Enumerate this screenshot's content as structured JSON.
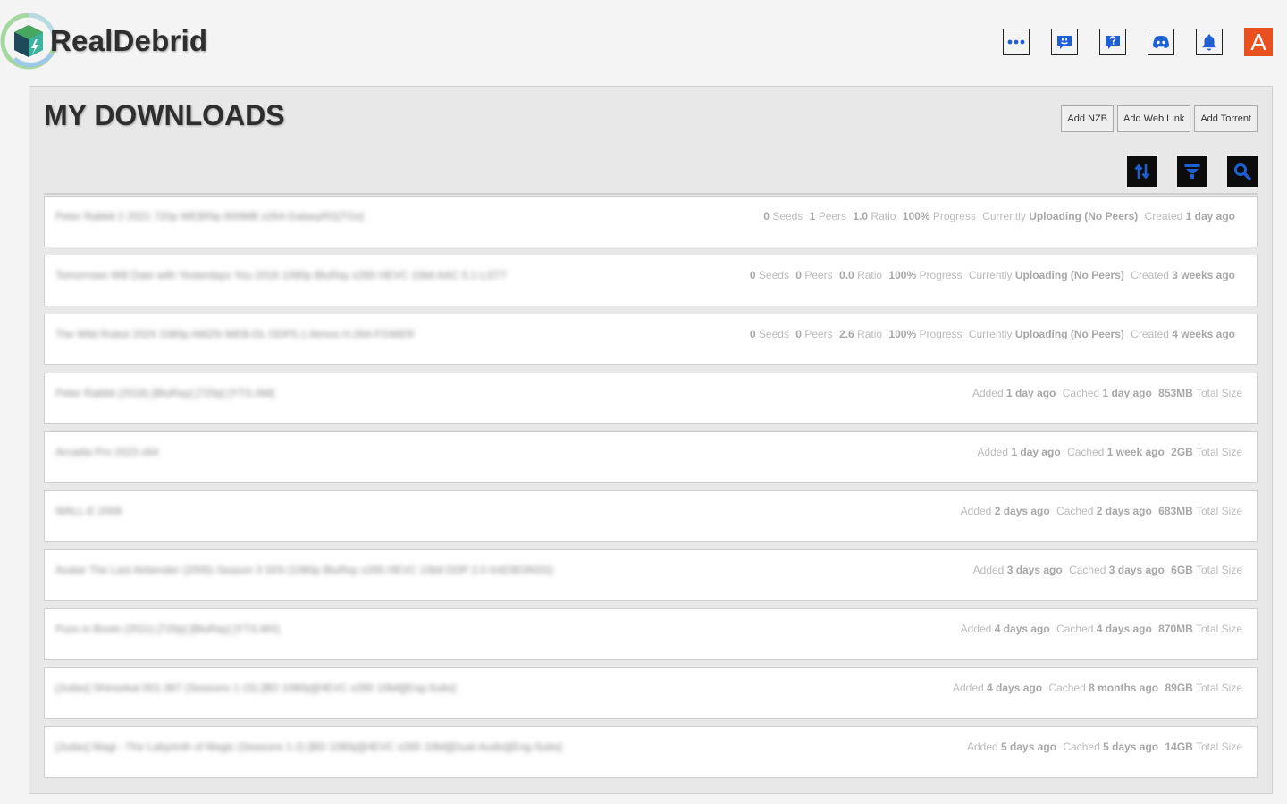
{
  "app": {
    "brand": "RealDebrid"
  },
  "header": {
    "icons": [
      "more-icon",
      "feedback-icon",
      "support-icon",
      "discord-icon",
      "bell-icon"
    ],
    "avatar_letter": "A"
  },
  "page": {
    "title": "MY DOWNLOADS",
    "buttons": {
      "add_nzb": "Add NZB",
      "add_web_link": "Add Web Link",
      "add_torrent": "Add Torrent"
    }
  },
  "labels": {
    "seeds": "Seeds",
    "peers": "Peers",
    "ratio": "Ratio",
    "progress": "Progress",
    "currently": "Currently",
    "created": "Created",
    "added": "Added",
    "cached": "Cached",
    "total_size": "Total Size"
  },
  "colors": {
    "accent": "#1e5fd4",
    "avatar_bg": "#e8511f",
    "logo_green": "#3fb04a"
  },
  "torrents": [
    {
      "name": "Peter Rabbit 2 2021 720p WEBRip 800MB x264-GalaxyRG[TGx]",
      "seeds": "0",
      "peers": "1",
      "ratio": "1.0",
      "progress": "100%",
      "status": "Uploading (No Peers)",
      "created": "1 day ago"
    },
    {
      "name": "Tomorrows Will Date with Yesterdays You 2016 1080p BluRay x265 HEVC 10bit AAC 5.1-LSTT",
      "seeds": "0",
      "peers": "0",
      "ratio": "0.0",
      "progress": "100%",
      "status": "Uploading (No Peers)",
      "created": "3 weeks ago"
    },
    {
      "name": "The Wild Robot 2024 1080p AMZN WEB-DL DDP5.1 Atmos H.264-FGWER",
      "seeds": "0",
      "peers": "0",
      "ratio": "2.6",
      "progress": "100%",
      "status": "Uploading (No Peers)",
      "created": "4 weeks ago"
    }
  ],
  "cached": [
    {
      "name": "Peter Rabbit (2018) [BluRay] [720p] [YTS.AM]",
      "added": "1 day ago",
      "cached": "1 day ago",
      "size": "853MB"
    },
    {
      "name": "Arcadia Pro 2023 x64",
      "added": "1 day ago",
      "cached": "1 week ago",
      "size": "2GB"
    },
    {
      "name": "WALL-E 2008",
      "added": "2 days ago",
      "cached": "2 days ago",
      "size": "683MB"
    },
    {
      "name": "Avatar The Last Airbender (2005) Season 3 S03 (1080p BluRay x265 HEVC 10bit DDP 2.0 ImE0E0NSS)",
      "added": "3 days ago",
      "cached": "3 days ago",
      "size": "6GB"
    },
    {
      "name": "Puss in Boots (2011) [720p] [BluRay] [YTS.MX]",
      "added": "4 days ago",
      "cached": "4 days ago",
      "size": "870MB"
    },
    {
      "name": "[Judas] Shinsekai 001-367 (Seasons 1-15) [BD 1080p][HEVC x265 10bit][Eng-Subs]",
      "added": "4 days ago",
      "cached": "8 months ago",
      "size": "89GB"
    },
    {
      "name": "[Judas] Magi - The Labyrinth of Magic (Seasons 1-2) [BD 1080p][HEVC x265 10bit][Dual-Audio][Eng-Subs]",
      "added": "5 days ago",
      "cached": "5 days ago",
      "size": "14GB"
    }
  ]
}
